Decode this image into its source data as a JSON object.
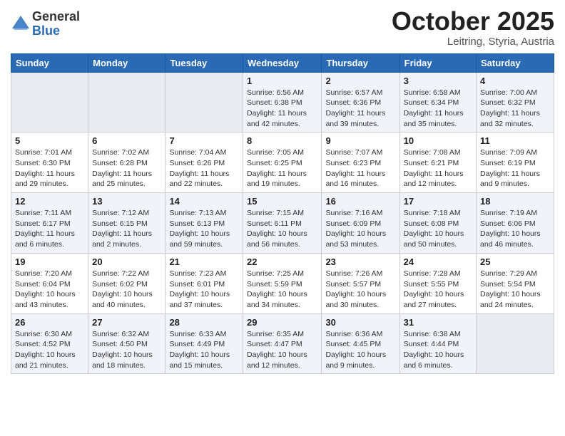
{
  "header": {
    "logo_general": "General",
    "logo_blue": "Blue",
    "month": "October 2025",
    "location": "Leitring, Styria, Austria"
  },
  "weekdays": [
    "Sunday",
    "Monday",
    "Tuesday",
    "Wednesday",
    "Thursday",
    "Friday",
    "Saturday"
  ],
  "weeks": [
    [
      {
        "day": "",
        "info": ""
      },
      {
        "day": "",
        "info": ""
      },
      {
        "day": "",
        "info": ""
      },
      {
        "day": "1",
        "info": "Sunrise: 6:56 AM\nSunset: 6:38 PM\nDaylight: 11 hours\nand 42 minutes."
      },
      {
        "day": "2",
        "info": "Sunrise: 6:57 AM\nSunset: 6:36 PM\nDaylight: 11 hours\nand 39 minutes."
      },
      {
        "day": "3",
        "info": "Sunrise: 6:58 AM\nSunset: 6:34 PM\nDaylight: 11 hours\nand 35 minutes."
      },
      {
        "day": "4",
        "info": "Sunrise: 7:00 AM\nSunset: 6:32 PM\nDaylight: 11 hours\nand 32 minutes."
      }
    ],
    [
      {
        "day": "5",
        "info": "Sunrise: 7:01 AM\nSunset: 6:30 PM\nDaylight: 11 hours\nand 29 minutes."
      },
      {
        "day": "6",
        "info": "Sunrise: 7:02 AM\nSunset: 6:28 PM\nDaylight: 11 hours\nand 25 minutes."
      },
      {
        "day": "7",
        "info": "Sunrise: 7:04 AM\nSunset: 6:26 PM\nDaylight: 11 hours\nand 22 minutes."
      },
      {
        "day": "8",
        "info": "Sunrise: 7:05 AM\nSunset: 6:25 PM\nDaylight: 11 hours\nand 19 minutes."
      },
      {
        "day": "9",
        "info": "Sunrise: 7:07 AM\nSunset: 6:23 PM\nDaylight: 11 hours\nand 16 minutes."
      },
      {
        "day": "10",
        "info": "Sunrise: 7:08 AM\nSunset: 6:21 PM\nDaylight: 11 hours\nand 12 minutes."
      },
      {
        "day": "11",
        "info": "Sunrise: 7:09 AM\nSunset: 6:19 PM\nDaylight: 11 hours\nand 9 minutes."
      }
    ],
    [
      {
        "day": "12",
        "info": "Sunrise: 7:11 AM\nSunset: 6:17 PM\nDaylight: 11 hours\nand 6 minutes."
      },
      {
        "day": "13",
        "info": "Sunrise: 7:12 AM\nSunset: 6:15 PM\nDaylight: 11 hours\nand 2 minutes."
      },
      {
        "day": "14",
        "info": "Sunrise: 7:13 AM\nSunset: 6:13 PM\nDaylight: 10 hours\nand 59 minutes."
      },
      {
        "day": "15",
        "info": "Sunrise: 7:15 AM\nSunset: 6:11 PM\nDaylight: 10 hours\nand 56 minutes."
      },
      {
        "day": "16",
        "info": "Sunrise: 7:16 AM\nSunset: 6:09 PM\nDaylight: 10 hours\nand 53 minutes."
      },
      {
        "day": "17",
        "info": "Sunrise: 7:18 AM\nSunset: 6:08 PM\nDaylight: 10 hours\nand 50 minutes."
      },
      {
        "day": "18",
        "info": "Sunrise: 7:19 AM\nSunset: 6:06 PM\nDaylight: 10 hours\nand 46 minutes."
      }
    ],
    [
      {
        "day": "19",
        "info": "Sunrise: 7:20 AM\nSunset: 6:04 PM\nDaylight: 10 hours\nand 43 minutes."
      },
      {
        "day": "20",
        "info": "Sunrise: 7:22 AM\nSunset: 6:02 PM\nDaylight: 10 hours\nand 40 minutes."
      },
      {
        "day": "21",
        "info": "Sunrise: 7:23 AM\nSunset: 6:01 PM\nDaylight: 10 hours\nand 37 minutes."
      },
      {
        "day": "22",
        "info": "Sunrise: 7:25 AM\nSunset: 5:59 PM\nDaylight: 10 hours\nand 34 minutes."
      },
      {
        "day": "23",
        "info": "Sunrise: 7:26 AM\nSunset: 5:57 PM\nDaylight: 10 hours\nand 30 minutes."
      },
      {
        "day": "24",
        "info": "Sunrise: 7:28 AM\nSunset: 5:55 PM\nDaylight: 10 hours\nand 27 minutes."
      },
      {
        "day": "25",
        "info": "Sunrise: 7:29 AM\nSunset: 5:54 PM\nDaylight: 10 hours\nand 24 minutes."
      }
    ],
    [
      {
        "day": "26",
        "info": "Sunrise: 6:30 AM\nSunset: 4:52 PM\nDaylight: 10 hours\nand 21 minutes."
      },
      {
        "day": "27",
        "info": "Sunrise: 6:32 AM\nSunset: 4:50 PM\nDaylight: 10 hours\nand 18 minutes."
      },
      {
        "day": "28",
        "info": "Sunrise: 6:33 AM\nSunset: 4:49 PM\nDaylight: 10 hours\nand 15 minutes."
      },
      {
        "day": "29",
        "info": "Sunrise: 6:35 AM\nSunset: 4:47 PM\nDaylight: 10 hours\nand 12 minutes."
      },
      {
        "day": "30",
        "info": "Sunrise: 6:36 AM\nSunset: 4:45 PM\nDaylight: 10 hours\nand 9 minutes."
      },
      {
        "day": "31",
        "info": "Sunrise: 6:38 AM\nSunset: 4:44 PM\nDaylight: 10 hours\nand 6 minutes."
      },
      {
        "day": "",
        "info": ""
      }
    ]
  ]
}
